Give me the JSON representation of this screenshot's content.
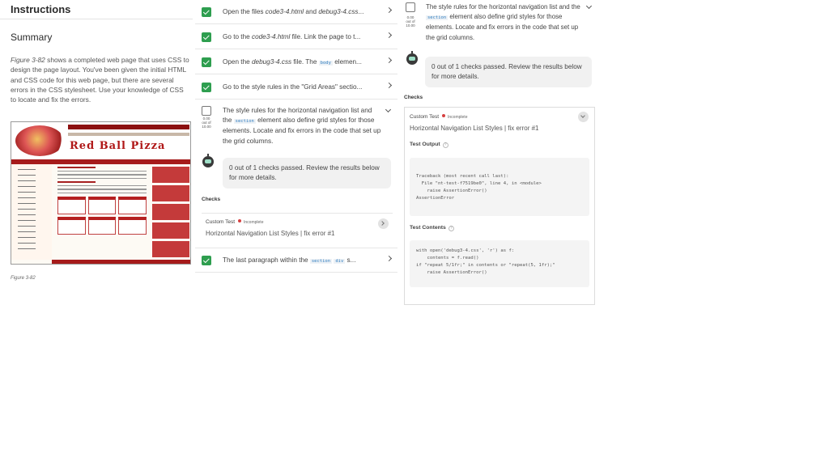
{
  "instructions": {
    "title": "Instructions",
    "summary_title": "Summary",
    "figure_ref": "Figure 3-82",
    "paragraph_rest": " shows a completed web page that uses CSS to design the page layout. You've been given the initial HTML and CSS code for this web page, but there are several errors in the CSS stylesheet. Use your knowledge of CSS to locate and fix the errors.",
    "figure": {
      "site_title": "Red Ball Pizza",
      "caption": "Figure 3-82"
    }
  },
  "tasks": [
    {
      "checked": true,
      "text_prefix": "Open the files ",
      "text_em": "code3-4.html",
      "text_mid": " and ",
      "text_em2": "debug3-4.css",
      "text_suffix": "..."
    },
    {
      "checked": true,
      "text_prefix": "Go to the ",
      "text_em": "code3-4.html",
      "text_suffix": " file. Link the page to t..."
    },
    {
      "checked": true,
      "text_prefix": "Open the ",
      "text_em": "debug3-4.css",
      "text_mid": " file. The ",
      "code": "body",
      "text_suffix": " elemen..."
    },
    {
      "checked": true,
      "text": "Go to the style rules in the \"Grid Areas\" sectio..."
    }
  ],
  "expanded_task": {
    "score_top": "0.00",
    "score_mid": "out of",
    "score_bottom": "10.00",
    "text_before": "The style rules for the horizontal navigation list and the ",
    "code": "section",
    "text_after": " element also define grid styles for those elements. Locate and fix errors in the code that set up the grid columns.",
    "feedback": "0 out of 1 checks passed. Review the results below for more details.",
    "checks_label": "Checks",
    "test": {
      "title": "Custom Test",
      "status": "Incomplete",
      "name": "Horizontal Navigation List Styles | fix error #1"
    }
  },
  "last_task": {
    "checked": true,
    "text_prefix": "The last paragraph within the ",
    "code1": "section",
    "code2": "div",
    "text_suffix": " s..."
  },
  "detail": {
    "score_top": "0.00",
    "score_mid": "out of",
    "score_bottom": "10.00",
    "text_before": "The style rules for the horizontal navigation list and the ",
    "code": "section",
    "text_after": " element also define grid styles for those elements. Locate and fix errors in the code that set up the grid columns.",
    "feedback": "0 out of 1 checks passed. Review the results below for more details.",
    "checks_label": "Checks",
    "test_title": "Custom Test",
    "test_status": "Incomplete",
    "test_name": "Horizontal Navigation List Styles | fix error #1",
    "output_label": "Test Output",
    "output_code": "Traceback (most recent call last):\n  File \"nt-test-f7519be0\", line 4, in <module>\n    raise AssertionError()\nAssertionError",
    "contents_label": "Test Contents",
    "contents_code": "with open('debug3-4.css', 'r') as f:\n    contents = f.read()\nif \"repeat 5/1fr;\" in contents or \"repeat(5, 1fr);\"\n    raise AssertionError()"
  },
  "colors": {
    "checkbox_checked": "#2e9e4f",
    "status_dot": "#d64040",
    "code_text": "#2e7cbf"
  }
}
